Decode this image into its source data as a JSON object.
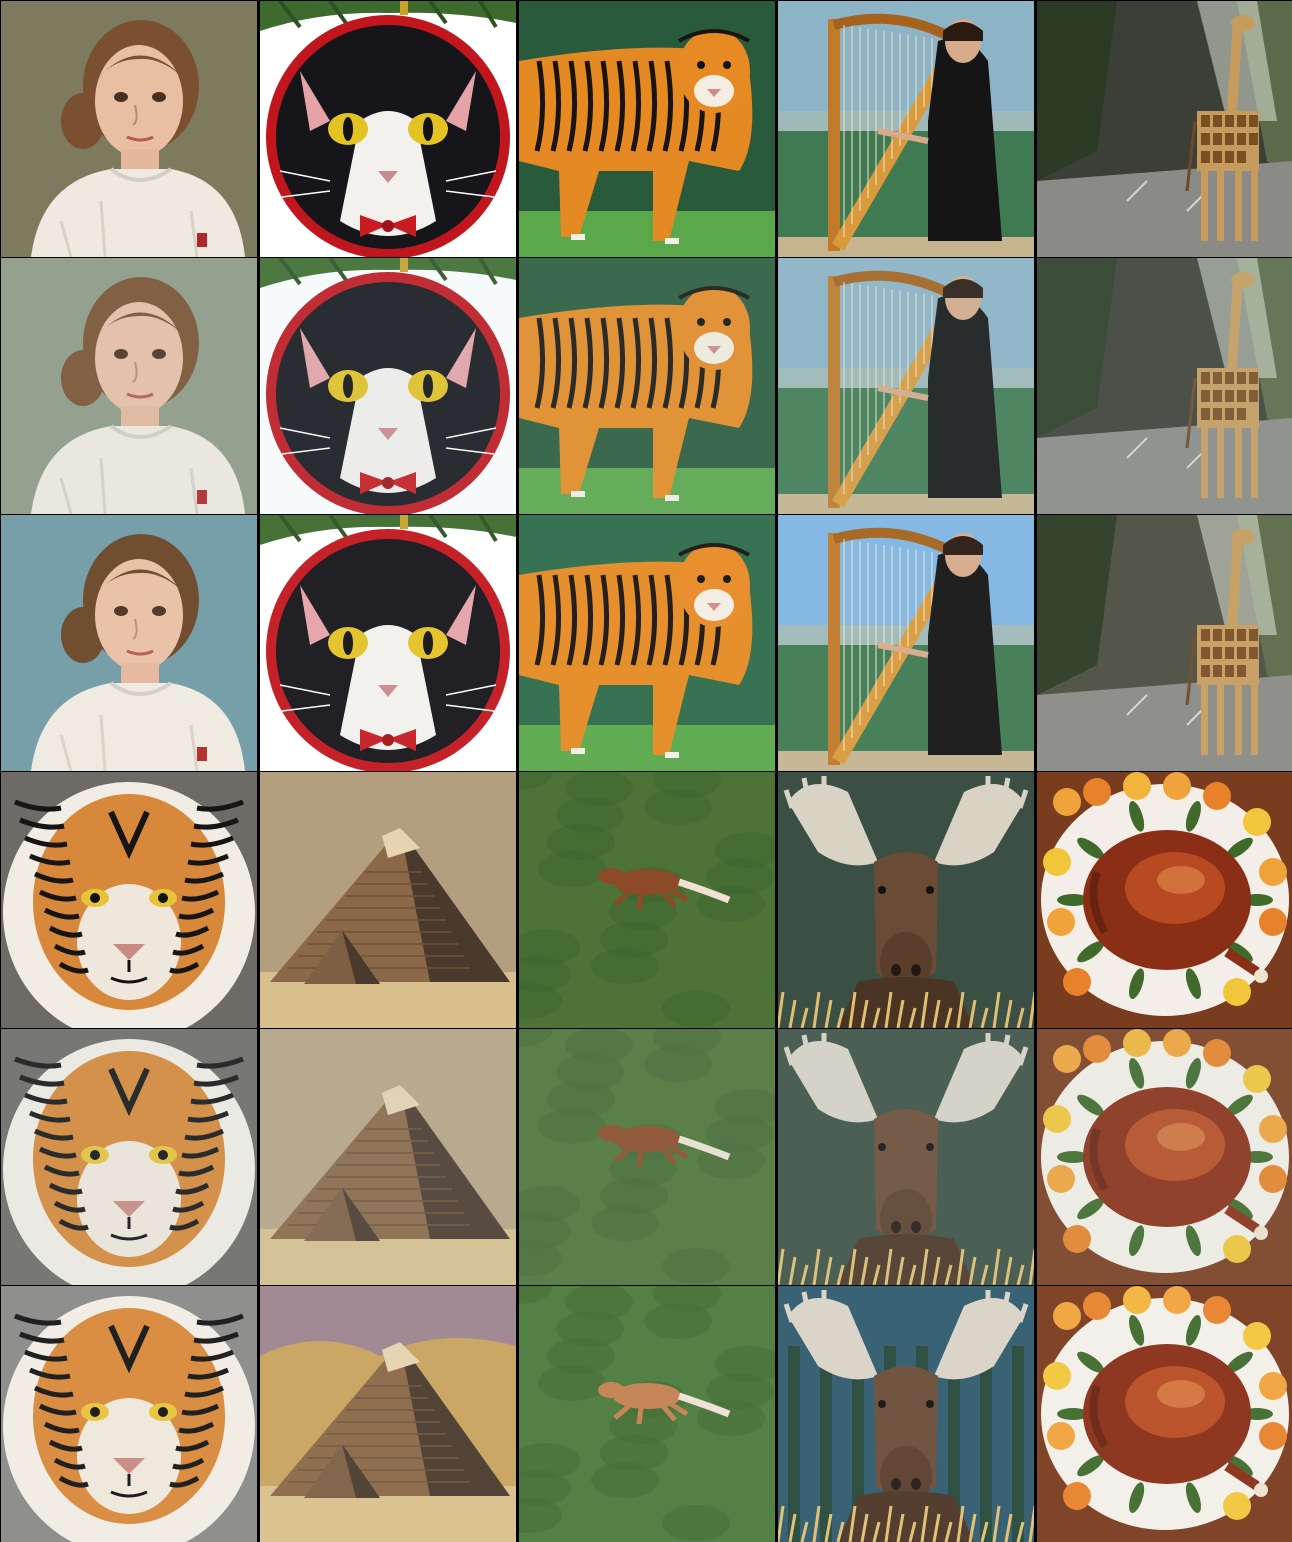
{
  "grid": {
    "columns": 5,
    "rows": 6,
    "border_color": "#000000"
  },
  "cells": [
    {
      "subject": "girl-portrait",
      "style": "painting"
    },
    {
      "subject": "tuxedo-cat-ornament",
      "style": "painting"
    },
    {
      "subject": "tiger-walking",
      "style": "painting"
    },
    {
      "subject": "harpist",
      "style": "painting"
    },
    {
      "subject": "giraffe-street",
      "style": "painting"
    },
    {
      "subject": "girl-portrait",
      "style": "painterly"
    },
    {
      "subject": "tuxedo-cat-ornament",
      "style": "painterly"
    },
    {
      "subject": "tiger-walking",
      "style": "painterly"
    },
    {
      "subject": "harpist",
      "style": "painterly"
    },
    {
      "subject": "giraffe-street",
      "style": "painterly"
    },
    {
      "subject": "girl-portrait",
      "style": "anime"
    },
    {
      "subject": "tuxedo-cat-ornament",
      "style": "anime"
    },
    {
      "subject": "tiger-walking",
      "style": "anime"
    },
    {
      "subject": "harpist",
      "style": "anime"
    },
    {
      "subject": "giraffe-street",
      "style": "anime"
    },
    {
      "subject": "tiger-face",
      "style": "photo"
    },
    {
      "subject": "pyramids",
      "style": "photo"
    },
    {
      "subject": "horse-on-grass",
      "style": "photo"
    },
    {
      "subject": "moose",
      "style": "photo"
    },
    {
      "subject": "roast-turkey",
      "style": "photo"
    },
    {
      "subject": "tiger-face",
      "style": "painterly"
    },
    {
      "subject": "pyramids",
      "style": "painterly"
    },
    {
      "subject": "horse-on-grass",
      "style": "painterly"
    },
    {
      "subject": "moose",
      "style": "painterly"
    },
    {
      "subject": "roast-turkey",
      "style": "painterly"
    },
    {
      "subject": "tiger-face",
      "style": "anime"
    },
    {
      "subject": "pyramids",
      "style": "anime"
    },
    {
      "subject": "horse-on-grass",
      "style": "anime"
    },
    {
      "subject": "moose",
      "style": "anime"
    },
    {
      "subject": "roast-turkey",
      "style": "anime"
    }
  ]
}
